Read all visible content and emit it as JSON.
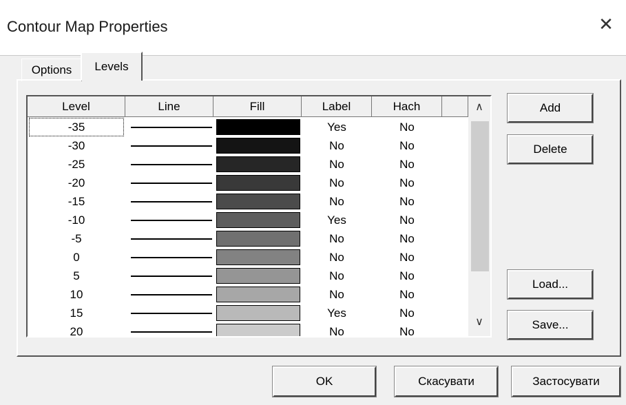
{
  "window": {
    "title": "Contour Map Properties",
    "close_glyph": "✕"
  },
  "tabs": [
    {
      "label": "Options"
    },
    {
      "label": "Levels"
    }
  ],
  "grid": {
    "headers": [
      "Level",
      "Line",
      "Fill",
      "Label",
      "Hach"
    ],
    "rows": [
      {
        "level": "-35",
        "label": "Yes",
        "hach": "No",
        "fill": "#000000"
      },
      {
        "level": "-30",
        "label": "No",
        "hach": "No",
        "fill": "#141414"
      },
      {
        "level": "-25",
        "label": "No",
        "hach": "No",
        "fill": "#262626"
      },
      {
        "level": "-20",
        "label": "No",
        "hach": "No",
        "fill": "#393939"
      },
      {
        "level": "-15",
        "label": "No",
        "hach": "No",
        "fill": "#4b4b4b"
      },
      {
        "level": "-10",
        "label": "Yes",
        "hach": "No",
        "fill": "#5d5d5d"
      },
      {
        "level": "-5",
        "label": "No",
        "hach": "No",
        "fill": "#707070"
      },
      {
        "level": "0",
        "label": "No",
        "hach": "No",
        "fill": "#828282"
      },
      {
        "level": "5",
        "label": "No",
        "hach": "No",
        "fill": "#959595"
      },
      {
        "level": "10",
        "label": "No",
        "hach": "No",
        "fill": "#a7a7a7"
      },
      {
        "level": "15",
        "label": "Yes",
        "hach": "No",
        "fill": "#b9b9b9"
      },
      {
        "level": "20",
        "label": "No",
        "hach": "No",
        "fill": "#cbcbcb"
      }
    ],
    "scroll_up_glyph": "∧",
    "scroll_down_glyph": "∨"
  },
  "side_buttons": {
    "add": "Add",
    "delete": "Delete",
    "load": "Load...",
    "save": "Save..."
  },
  "footer_buttons": {
    "ok": "OK",
    "cancel": "Скасувати",
    "apply": "Застосувати"
  }
}
